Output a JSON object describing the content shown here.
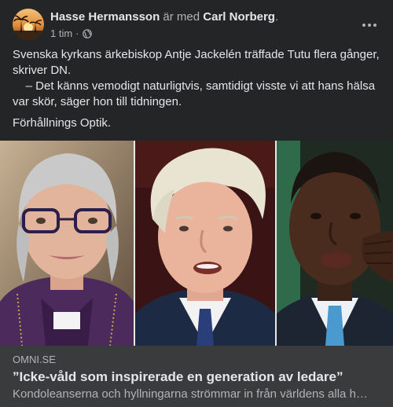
{
  "post": {
    "author": "Hasse Hermansson",
    "with_text": "är med",
    "tagged": "Carl Norberg",
    "period": ".",
    "time": "1 tim",
    "dot": "·",
    "body": {
      "line1": "Svenska kyrkans ärkebiskop Antje Jackelén träffade Tutu flera gånger, skriver DN.",
      "line2": "    – Det känns vemodigt naturligtvis, samtidigt visste vi att hans hälsa var skör, säger hon till tidningen.",
      "line3": "Förhållnings Optik."
    }
  },
  "link": {
    "domain": "OMNI.SE",
    "title": "”Icke-våld som inspirerade en generation av ledare”",
    "description": "Kondoleanserna och hyllningarna strömmar in från världens alla h…"
  },
  "icons": {
    "privacy": "globe-icon",
    "menu": "more-options-icon"
  }
}
